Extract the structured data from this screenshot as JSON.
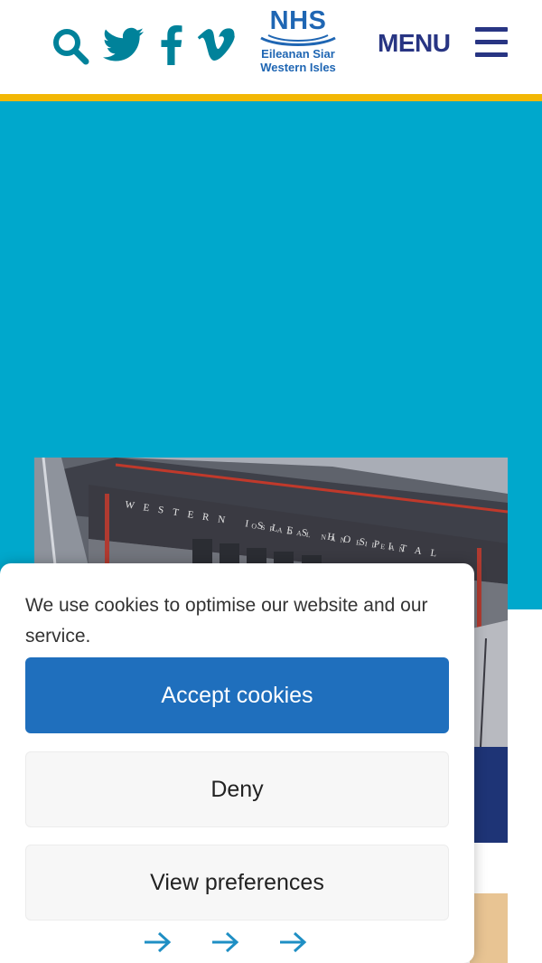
{
  "header": {
    "icons": [
      "search-icon",
      "twitter-icon",
      "facebook-icon",
      "vimeo-icon"
    ],
    "logo": {
      "title": "NHS",
      "line1": "Eileanan Siar",
      "line2": "Western Isles"
    },
    "menu_label": "MENU"
  },
  "hero": {
    "building_sign_line1": "WESTERN ISLES HOSPITAL",
    "building_sign_line2": "OSPADAL NAN EILEAN"
  },
  "cookie_banner": {
    "message": "We use cookies to optimise our website and our service.",
    "accept_label": "Accept cookies",
    "deny_label": "Deny",
    "preferences_label": "View preferences",
    "arrow_icons": [
      "arrow-right-icon",
      "arrow-right-icon",
      "arrow-right-icon"
    ]
  },
  "colors": {
    "header_accent": "#f2b705",
    "hero_bg": "#00a8cc",
    "nhs_blue": "#1f66b3",
    "navy": "#283583",
    "social_icon": "#00829a",
    "accept_button": "#1f6fbd"
  }
}
